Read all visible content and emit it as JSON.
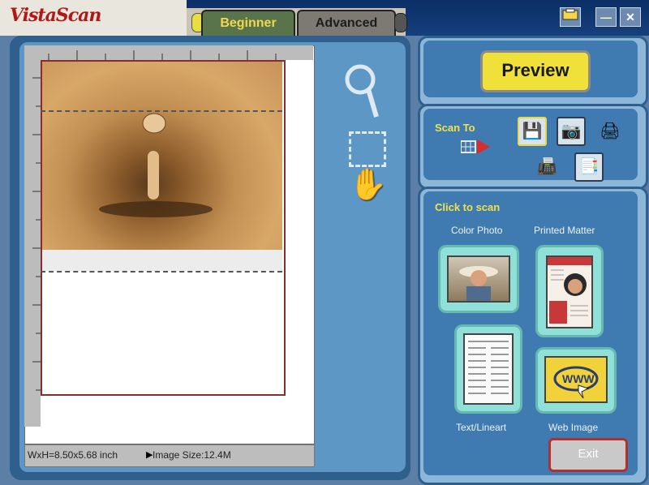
{
  "app": {
    "logo": "VistaScan"
  },
  "mode_tabs": {
    "beginner": "Beginner",
    "advanced": "Advanced"
  },
  "window_controls": {
    "minimize": "—",
    "close": "✕"
  },
  "status": {
    "size": "WxH=8.50x5.68 inch",
    "image_size": "Image Size:12.4M",
    "arrow": "▶"
  },
  "tools": {
    "zoom": "🔍",
    "hand": "✋"
  },
  "preview": {
    "label": "Preview"
  },
  "scan_to": {
    "label": "Scan To"
  },
  "click_to_scan": {
    "label": "Click to scan",
    "color_photo": "Color Photo",
    "printed_matter": "Printed Matter",
    "text_lineart": "Text/Lineart",
    "web_image": "Web Image",
    "www": "WWW"
  },
  "exit": {
    "label": "Exit"
  }
}
